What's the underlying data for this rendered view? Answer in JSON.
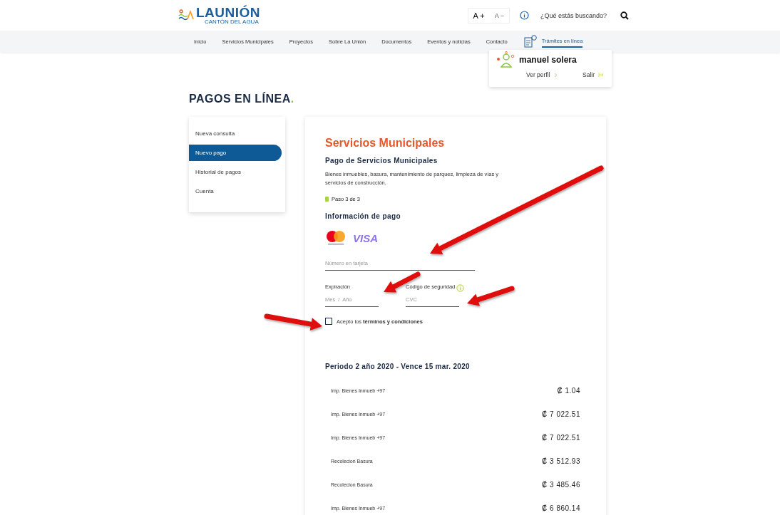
{
  "header": {
    "logo": {
      "name": "LAUNIÓN",
      "tagline": "CANTÓN DEL AGUA"
    },
    "font_buttons": [
      "A +",
      "A −"
    ],
    "search": {
      "placeholder": "¿Qué estás buscando?"
    }
  },
  "nav": {
    "items": [
      {
        "label": "Inicio",
        "selected": false
      },
      {
        "label": "Servicios Municipales",
        "selected": false
      },
      {
        "label": "Proyectos",
        "selected": false
      },
      {
        "label": "Sobre La Unión",
        "selected": false
      },
      {
        "label": "Documentos",
        "selected": false
      },
      {
        "label": "Eventos y noticias",
        "selected": false
      },
      {
        "label": "Contacto",
        "selected": false
      },
      {
        "label": "Trámites en línea",
        "selected": true
      }
    ]
  },
  "user_menu": {
    "name": "manuel solera",
    "profile_link": "Ver perfil",
    "logout_link": "Salir"
  },
  "page_title": "PAGOS EN LÍNEA",
  "title_mark": ".",
  "sidebar": {
    "items": [
      {
        "label": "Nueva consulta",
        "selected": false
      },
      {
        "label": "Nuevo pago",
        "selected": true
      },
      {
        "label": "Historial de pagos",
        "selected": false
      },
      {
        "label": "Cuenta",
        "selected": false
      }
    ]
  },
  "payment": {
    "title": "Servicios Municipales",
    "subtitle": "Pago de Servicios Municipales",
    "description": "Bienes inmuebles, basura, mantenimiento de parques, limpieza de vías y servicios de construcción.",
    "step": "Paso 3 de 3",
    "section_title": "Información de pago",
    "card_brand": "VISA",
    "card_number": {
      "placeholder": "Número en tarjeta"
    },
    "expiration": {
      "label": "Expiración",
      "placeholder": "Mes  /  Año"
    },
    "security_code": {
      "label": "Código de seguridad",
      "placeholder": "CVC"
    },
    "terms": {
      "text": "Acepto los **términos y condiciones**",
      "checked": false
    }
  },
  "period": {
    "title": "Periodo 2 año 2020 - Vence 15 mar. 2020",
    "rows": [
      {
        "concept": "Imp. Bienes Inmueb +97",
        "amount": "₡ 1.04"
      },
      {
        "concept": "Imp. Bienes Inmueb +97",
        "amount": "₡ 7 022.51"
      },
      {
        "concept": "Imp. Bienes Inmueb +97",
        "amount": "₡ 7 022.51"
      },
      {
        "concept": "Recolecion Basura",
        "amount": "₡ 3 512.93"
      },
      {
        "concept": "Recolecion Basura",
        "amount": "₡ 3 485.46"
      },
      {
        "concept": "Imp. Bienes Inmueb +97",
        "amount": "₡ 6 860.14"
      }
    ]
  }
}
